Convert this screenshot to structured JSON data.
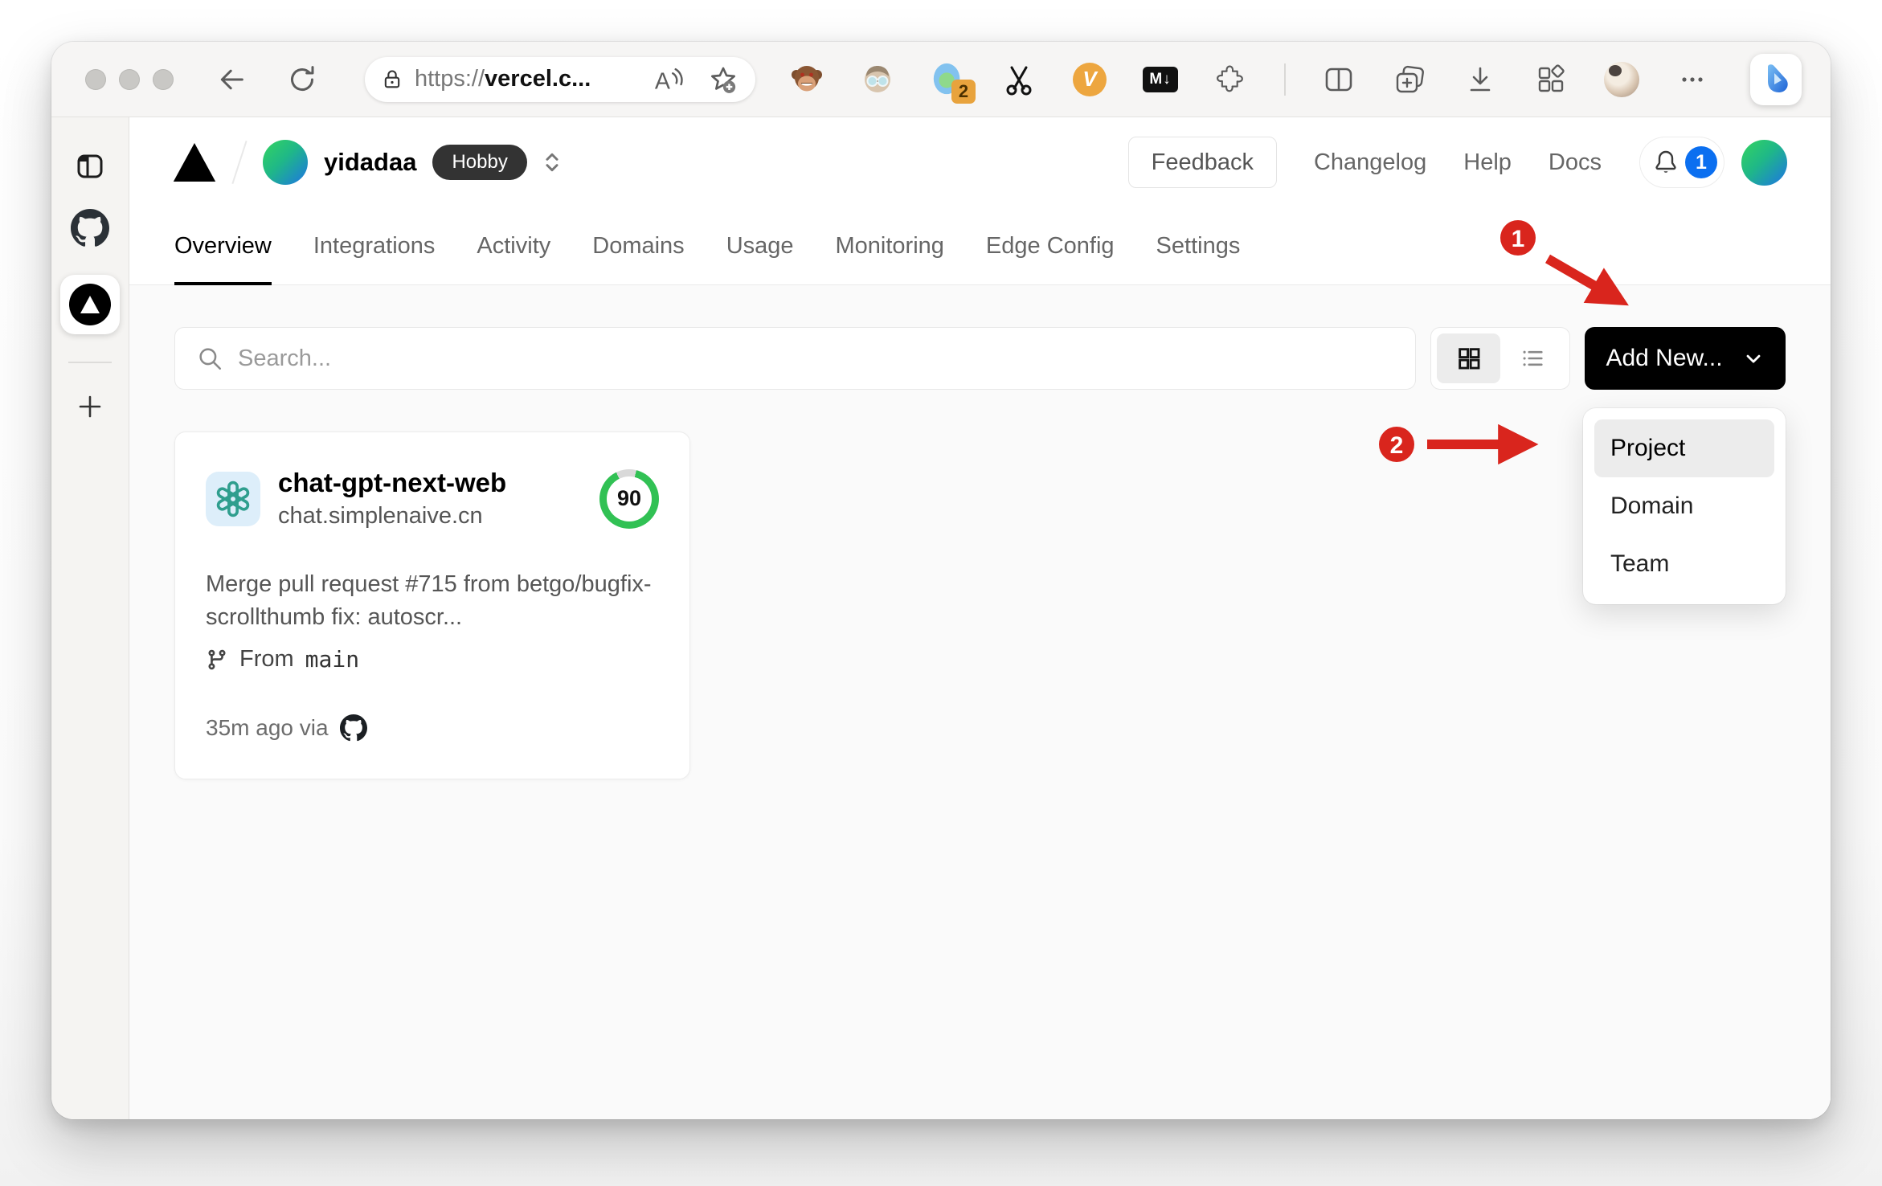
{
  "browser": {
    "url_scheme": "https://",
    "url_host": "vercel.c...",
    "extension_badge": "2",
    "markdown_icon_label": "M↓",
    "violentmonkey_icon_label": "V"
  },
  "header": {
    "team_name": "yidadaa",
    "plan_badge": "Hobby",
    "feedback_label": "Feedback",
    "changelog_label": "Changelog",
    "help_label": "Help",
    "docs_label": "Docs",
    "notification_count": "1"
  },
  "tabs": [
    {
      "label": "Overview",
      "active": true
    },
    {
      "label": "Integrations",
      "active": false
    },
    {
      "label": "Activity",
      "active": false
    },
    {
      "label": "Domains",
      "active": false
    },
    {
      "label": "Usage",
      "active": false
    },
    {
      "label": "Monitoring",
      "active": false
    },
    {
      "label": "Edge Config",
      "active": false
    },
    {
      "label": "Settings",
      "active": false
    }
  ],
  "toolbar": {
    "search_placeholder": "Search...",
    "add_new_label": "Add New..."
  },
  "dropdown": {
    "items": [
      {
        "label": "Project",
        "highlighted": true
      },
      {
        "label": "Domain",
        "highlighted": false
      },
      {
        "label": "Team",
        "highlighted": false
      }
    ]
  },
  "project_card": {
    "name": "chat-gpt-next-web",
    "domain": "chat.simplenaive.cn",
    "score": "90",
    "commit_message": "Merge pull request #715 from betgo/bugfix-scrollthumb fix: autoscr...",
    "branch_prefix": "From",
    "branch_name": "main",
    "deployed": "35m ago via"
  },
  "annotations": {
    "step1": "1",
    "step2": "2"
  },
  "colors": {
    "annotation_red": "#d9251d",
    "ring_green": "#31c154",
    "badge_blue": "#0b6ff0",
    "plan_badge_bg": "#333333"
  }
}
